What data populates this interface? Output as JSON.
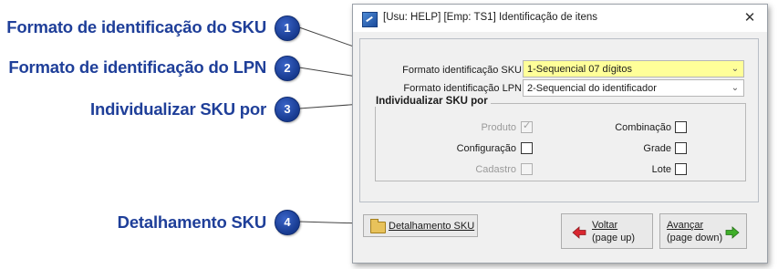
{
  "callouts": [
    {
      "num": "1",
      "label": "Formato de identificação do SKU"
    },
    {
      "num": "2",
      "label": "Formato de identificação do LPN"
    },
    {
      "num": "3",
      "label": "Individualizar SKU por"
    },
    {
      "num": "4",
      "label": "Detalhamento SKU"
    }
  ],
  "window": {
    "title": "[Usu: HELP] [Emp: TS1] Identificação de itens",
    "close_symbol": "✕"
  },
  "form": {
    "sku_format": {
      "label": "Formato identificação SKU",
      "value": "1-Sequencial 07 dígitos",
      "highlight": "#ffff99"
    },
    "lpn_format": {
      "label": "Formato identificação LPN",
      "value": "2-Sequencial do identificador"
    }
  },
  "group": {
    "title": "Individualizar SKU por",
    "options": [
      {
        "label": "Produto",
        "checked": true,
        "enabled": false
      },
      {
        "label": "Combinação",
        "checked": false,
        "enabled": true
      },
      {
        "label": "Configuração",
        "checked": false,
        "enabled": true
      },
      {
        "label": "Grade",
        "checked": false,
        "enabled": true
      },
      {
        "label": "Cadastro",
        "checked": false,
        "enabled": false
      },
      {
        "label": "Lote",
        "checked": false,
        "enabled": true
      }
    ]
  },
  "buttons": {
    "detalhamento": "Detalhamento SKU",
    "voltar": {
      "label": "Voltar",
      "sub": "(page up)"
    },
    "avancar": {
      "label": "Avançar",
      "sub": "(page down)"
    }
  },
  "colors": {
    "callout_blue": "#1f3f99",
    "arrow_left": "#d9262f",
    "arrow_right": "#3fae29"
  },
  "icons": [
    "app-icon",
    "close-icon",
    "chevron-down-icon",
    "checkmark-icon",
    "folder-icon",
    "arrow-left-icon",
    "arrow-right-icon"
  ]
}
